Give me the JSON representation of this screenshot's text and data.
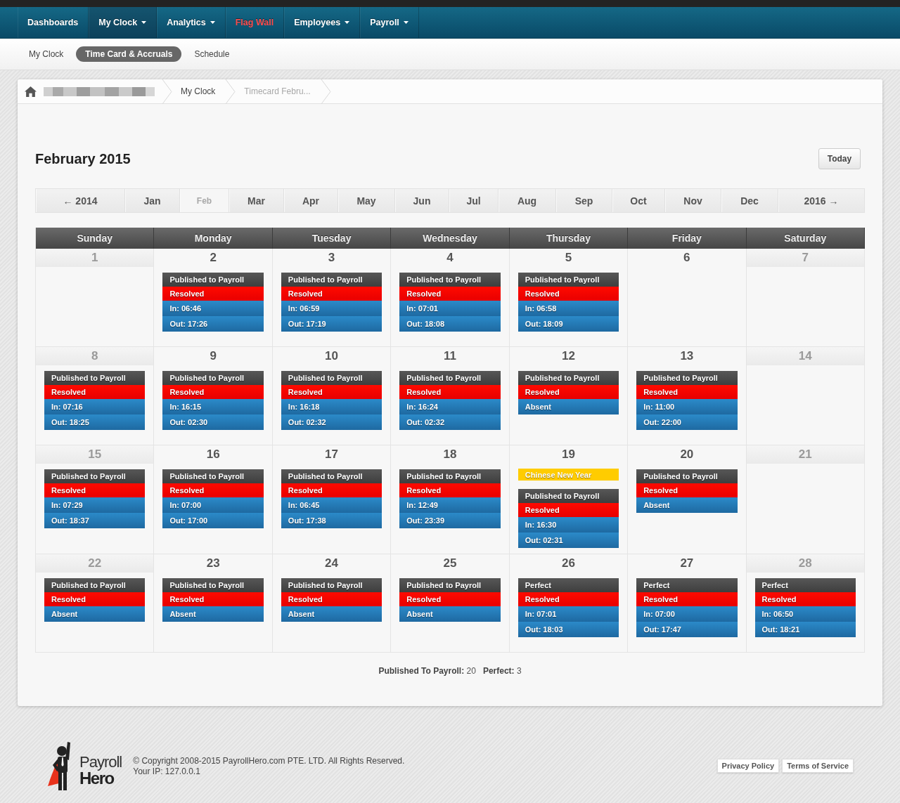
{
  "top_nav": [
    {
      "label": "Dashboards",
      "selected": false,
      "dropdown": false,
      "kind": "normal"
    },
    {
      "label": "My Clock",
      "selected": true,
      "dropdown": true,
      "kind": "normal"
    },
    {
      "label": "Analytics",
      "selected": false,
      "dropdown": true,
      "kind": "normal"
    },
    {
      "label": "Flag Wall",
      "selected": false,
      "dropdown": false,
      "kind": "alert"
    },
    {
      "label": "Employees",
      "selected": false,
      "dropdown": true,
      "kind": "normal"
    },
    {
      "label": "Payroll",
      "selected": false,
      "dropdown": true,
      "kind": "normal"
    }
  ],
  "sub_nav": [
    {
      "label": "My Clock",
      "selected": false
    },
    {
      "label": "Time Card & Accruals",
      "selected": true
    },
    {
      "label": "Schedule",
      "selected": false
    }
  ],
  "breadcrumb": [
    {
      "label": "My Clock",
      "current": false
    },
    {
      "label": "Timecard Febru...",
      "current": true
    }
  ],
  "calendar": {
    "title": "February 2015",
    "today_button": "Today",
    "months": [
      {
        "label": "← 2014",
        "selected": false
      },
      {
        "label": "Jan",
        "selected": false
      },
      {
        "label": "Feb",
        "selected": true
      },
      {
        "label": "Mar",
        "selected": false
      },
      {
        "label": "Apr",
        "selected": false
      },
      {
        "label": "May",
        "selected": false
      },
      {
        "label": "Jun",
        "selected": false
      },
      {
        "label": "Jul",
        "selected": false
      },
      {
        "label": "Aug",
        "selected": false
      },
      {
        "label": "Sep",
        "selected": false
      },
      {
        "label": "Oct",
        "selected": false
      },
      {
        "label": "Nov",
        "selected": false
      },
      {
        "label": "Dec",
        "selected": false
      },
      {
        "label": "2016 →",
        "selected": false
      }
    ],
    "weekdays": [
      "Sunday",
      "Monday",
      "Tuesday",
      "Wednesday",
      "Thursday",
      "Friday",
      "Saturday"
    ],
    "weeks": [
      {
        "days": [
          {
            "day": "1",
            "weekend": true
          },
          {
            "day": "2",
            "weekend": false,
            "card": {
              "status": "Published to Payroll",
              "resolution": "Resolved",
              "lines": [
                "In: 06:46",
                "Out: 17:26"
              ]
            }
          },
          {
            "day": "3",
            "weekend": false,
            "card": {
              "status": "Published to Payroll",
              "resolution": "Resolved",
              "lines": [
                "In: 06:59",
                "Out: 17:19"
              ]
            }
          },
          {
            "day": "4",
            "weekend": false,
            "card": {
              "status": "Published to Payroll",
              "resolution": "Resolved",
              "lines": [
                "In: 07:01",
                "Out: 18:08"
              ]
            }
          },
          {
            "day": "5",
            "weekend": false,
            "card": {
              "status": "Published to Payroll",
              "resolution": "Resolved",
              "lines": [
                "In: 06:58",
                "Out: 18:09"
              ]
            }
          },
          {
            "day": "6",
            "weekend": false
          },
          {
            "day": "7",
            "weekend": true
          }
        ]
      },
      {
        "days": [
          {
            "day": "8",
            "weekend": true,
            "card": {
              "status": "Published to Payroll",
              "resolution": "Resolved",
              "lines": [
                "In: 07:16",
                "Out: 18:25"
              ]
            }
          },
          {
            "day": "9",
            "weekend": false,
            "card": {
              "status": "Published to Payroll",
              "resolution": "Resolved",
              "lines": [
                "In: 16:15",
                "Out: 02:30"
              ]
            }
          },
          {
            "day": "10",
            "weekend": false,
            "card": {
              "status": "Published to Payroll",
              "resolution": "Resolved",
              "lines": [
                "In: 16:18",
                "Out: 02:32"
              ]
            }
          },
          {
            "day": "11",
            "weekend": false,
            "card": {
              "status": "Published to Payroll",
              "resolution": "Resolved",
              "lines": [
                "In: 16:24",
                "Out: 02:32"
              ]
            }
          },
          {
            "day": "12",
            "weekend": false,
            "card": {
              "status": "Published to Payroll",
              "resolution": "Resolved",
              "lines": [
                "Absent"
              ]
            }
          },
          {
            "day": "13",
            "weekend": false,
            "card": {
              "status": "Published to Payroll",
              "resolution": "Resolved",
              "lines": [
                "In: 11:00",
                "Out: 22:00"
              ]
            }
          },
          {
            "day": "14",
            "weekend": true
          }
        ]
      },
      {
        "days": [
          {
            "day": "15",
            "weekend": true,
            "card": {
              "status": "Published to Payroll",
              "resolution": "Resolved",
              "lines": [
                "In: 07:29",
                "Out: 18:37"
              ]
            }
          },
          {
            "day": "16",
            "weekend": false,
            "card": {
              "status": "Published to Payroll",
              "resolution": "Resolved",
              "lines": [
                "In: 07:00",
                "Out: 17:00"
              ]
            }
          },
          {
            "day": "17",
            "weekend": false,
            "card": {
              "status": "Published to Payroll",
              "resolution": "Resolved",
              "lines": [
                "In: 06:45",
                "Out: 17:38"
              ]
            }
          },
          {
            "day": "18",
            "weekend": false,
            "card": {
              "status": "Published to Payroll",
              "resolution": "Resolved",
              "lines": [
                "In: 12:49",
                "Out: 23:39"
              ]
            }
          },
          {
            "day": "19",
            "weekend": false,
            "holiday": "Chinese New Year",
            "card": {
              "status": "Published to Payroll",
              "resolution": "Resolved",
              "lines": [
                "In: 16:30",
                "Out: 02:31"
              ]
            }
          },
          {
            "day": "20",
            "weekend": false,
            "card": {
              "status": "Published to Payroll",
              "resolution": "Resolved",
              "lines": [
                "Absent"
              ]
            }
          },
          {
            "day": "21",
            "weekend": true
          }
        ]
      },
      {
        "days": [
          {
            "day": "22",
            "weekend": true,
            "card": {
              "status": "Published to Payroll",
              "resolution": "Resolved",
              "lines": [
                "Absent"
              ]
            }
          },
          {
            "day": "23",
            "weekend": false,
            "card": {
              "status": "Published to Payroll",
              "resolution": "Resolved",
              "lines": [
                "Absent"
              ]
            }
          },
          {
            "day": "24",
            "weekend": false,
            "card": {
              "status": "Published to Payroll",
              "resolution": "Resolved",
              "lines": [
                "Absent"
              ]
            }
          },
          {
            "day": "25",
            "weekend": false,
            "card": {
              "status": "Published to Payroll",
              "resolution": "Resolved",
              "lines": [
                "Absent"
              ]
            }
          },
          {
            "day": "26",
            "weekend": false,
            "card": {
              "status": "Perfect",
              "resolution": "Resolved",
              "lines": [
                "In: 07:01",
                "Out: 18:03"
              ]
            }
          },
          {
            "day": "27",
            "weekend": false,
            "card": {
              "status": "Perfect",
              "resolution": "Resolved",
              "lines": [
                "In: 07:00",
                "Out: 17:47"
              ]
            }
          },
          {
            "day": "28",
            "weekend": true,
            "card": {
              "status": "Perfect",
              "resolution": "Resolved",
              "lines": [
                "In: 06:50",
                "Out: 18:21"
              ]
            }
          }
        ]
      }
    ],
    "summary": [
      "**Published To Payroll:** 20",
      "**Perfect:** 3"
    ]
  },
  "footer": {
    "logo": {
      "line1": "Payroll",
      "line2": "Hero"
    },
    "copyright": "© Copyright 2008-2015 PayrollHero.com PTE. LTD. All Rights Reserved.",
    "ip": "Your IP: 127.0.0.1",
    "links": [
      "Privacy Policy",
      "Terms of Service"
    ]
  }
}
